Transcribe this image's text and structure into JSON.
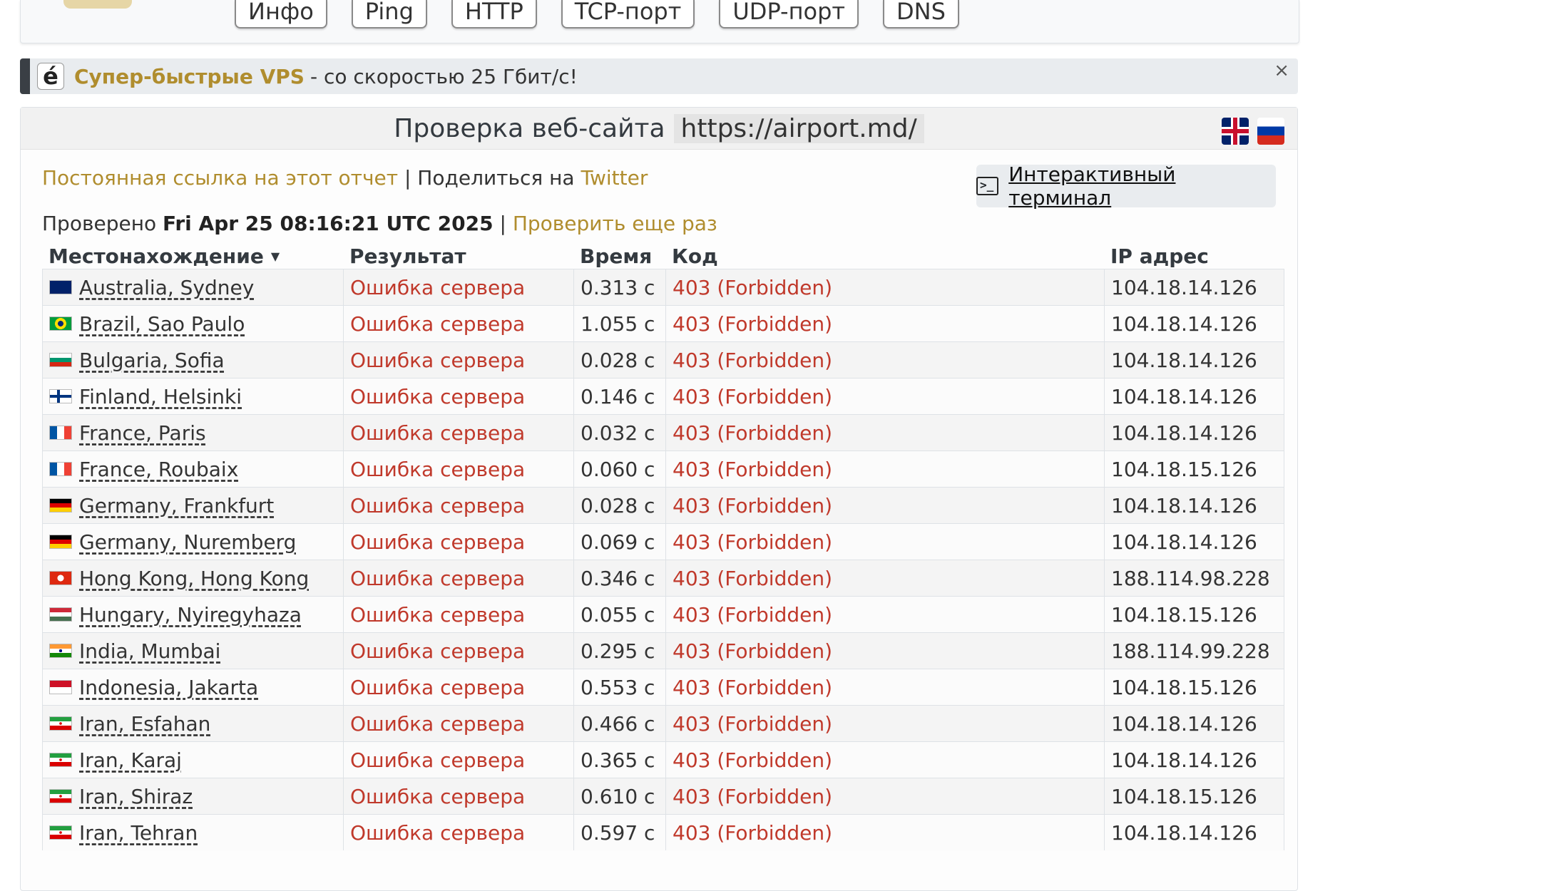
{
  "tabs": [
    "Инфо",
    "Ping",
    "HTTP",
    "TCP-порт",
    "UDP-порт",
    "DNS"
  ],
  "promo": {
    "logo_char": "é",
    "title": "Супер-быстрые VPS",
    "text": "- со скоростью 25 Гбит/с!",
    "close": "×"
  },
  "header": {
    "title": "Проверка веб-сайта",
    "url": "https://airport.md/"
  },
  "links": {
    "permalink": "Постоянная ссылка на этот отчет",
    "sep": " | Поделиться на ",
    "twitter": "Twitter"
  },
  "terminal": {
    "label": "Интерактивный терминал",
    "glyph": ">_"
  },
  "checked": {
    "prefix": "Проверено ",
    "datetime": "Fri Apr 25 08:16:21 UTC 2025",
    "sep": " | ",
    "recheck": "Проверить еще раз"
  },
  "table": {
    "headers": {
      "location": "Местонахождение",
      "sort_glyph": "▼",
      "result": "Результат",
      "time": "Время",
      "code": "Код",
      "ip": "IP адрес"
    },
    "rows": [
      {
        "flag": "au",
        "location": "Australia, Sydney",
        "result": "Ошибка сервера",
        "time": "0.313 с",
        "code": "403 (Forbidden)",
        "ip": "104.18.14.126"
      },
      {
        "flag": "br",
        "location": "Brazil, Sao Paulo",
        "result": "Ошибка сервера",
        "time": "1.055 с",
        "code": "403 (Forbidden)",
        "ip": "104.18.14.126"
      },
      {
        "flag": "bg",
        "location": "Bulgaria, Sofia",
        "result": "Ошибка сервера",
        "time": "0.028 с",
        "code": "403 (Forbidden)",
        "ip": "104.18.14.126"
      },
      {
        "flag": "fi",
        "location": "Finland, Helsinki",
        "result": "Ошибка сервера",
        "time": "0.146 с",
        "code": "403 (Forbidden)",
        "ip": "104.18.14.126"
      },
      {
        "flag": "fr",
        "location": "France, Paris",
        "result": "Ошибка сервера",
        "time": "0.032 с",
        "code": "403 (Forbidden)",
        "ip": "104.18.14.126"
      },
      {
        "flag": "fr",
        "location": "France, Roubaix",
        "result": "Ошибка сервера",
        "time": "0.060 с",
        "code": "403 (Forbidden)",
        "ip": "104.18.15.126"
      },
      {
        "flag": "de",
        "location": "Germany, Frankfurt",
        "result": "Ошибка сервера",
        "time": "0.028 с",
        "code": "403 (Forbidden)",
        "ip": "104.18.14.126"
      },
      {
        "flag": "de",
        "location": "Germany, Nuremberg",
        "result": "Ошибка сервера",
        "time": "0.069 с",
        "code": "403 (Forbidden)",
        "ip": "104.18.14.126"
      },
      {
        "flag": "hk",
        "location": "Hong Kong, Hong Kong",
        "result": "Ошибка сервера",
        "time": "0.346 с",
        "code": "403 (Forbidden)",
        "ip": "188.114.98.228"
      },
      {
        "flag": "hu",
        "location": "Hungary, Nyiregyhaza",
        "result": "Ошибка сервера",
        "time": "0.055 с",
        "code": "403 (Forbidden)",
        "ip": "104.18.15.126"
      },
      {
        "flag": "in",
        "location": "India, Mumbai",
        "result": "Ошибка сервера",
        "time": "0.295 с",
        "code": "403 (Forbidden)",
        "ip": "188.114.99.228"
      },
      {
        "flag": "id",
        "location": "Indonesia, Jakarta",
        "result": "Ошибка сервера",
        "time": "0.553 с",
        "code": "403 (Forbidden)",
        "ip": "104.18.15.126"
      },
      {
        "flag": "ir",
        "location": "Iran, Esfahan",
        "result": "Ошибка сервера",
        "time": "0.466 с",
        "code": "403 (Forbidden)",
        "ip": "104.18.14.126"
      },
      {
        "flag": "ir",
        "location": "Iran, Karaj",
        "result": "Ошибка сервера",
        "time": "0.365 с",
        "code": "403 (Forbidden)",
        "ip": "104.18.14.126"
      },
      {
        "flag": "ir",
        "location": "Iran, Shiraz",
        "result": "Ошибка сервера",
        "time": "0.610 с",
        "code": "403 (Forbidden)",
        "ip": "104.18.15.126"
      },
      {
        "flag": "ir",
        "location": "Iran, Tehran",
        "result": "Ошибка сервера",
        "time": "0.597 с",
        "code": "403 (Forbidden)",
        "ip": "104.18.14.126"
      }
    ]
  },
  "colors": {
    "gold": "#b08d2e",
    "error": "#c0392b"
  }
}
